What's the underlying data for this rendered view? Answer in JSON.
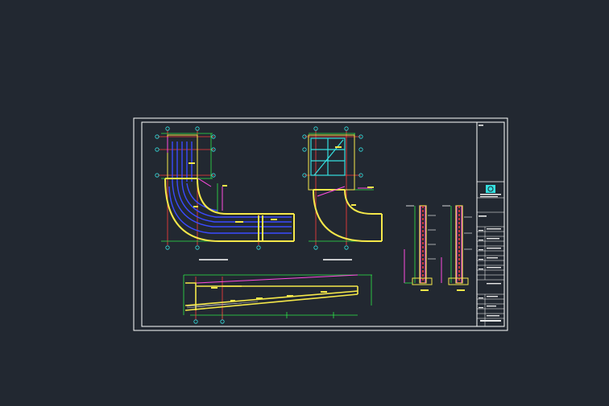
{
  "viewer": {
    "background_color": "#222831"
  },
  "sheet": {
    "line_colors": {
      "frame": "#ffffff",
      "outline": "#f5e84a",
      "gridline": "#ff3b3b",
      "rebar": "#3a4bff",
      "dimension": "#2ee84a",
      "annotation": "#ff4be0",
      "axis_bubble": "#35e0e0"
    }
  },
  "drawings": [
    {
      "name": "plan-view-1"
    },
    {
      "name": "plan-view-2"
    },
    {
      "name": "wall-section-pair"
    },
    {
      "name": "longitudinal-section"
    }
  ],
  "title_block": {
    "logo_icon": "company-logo-icon"
  }
}
